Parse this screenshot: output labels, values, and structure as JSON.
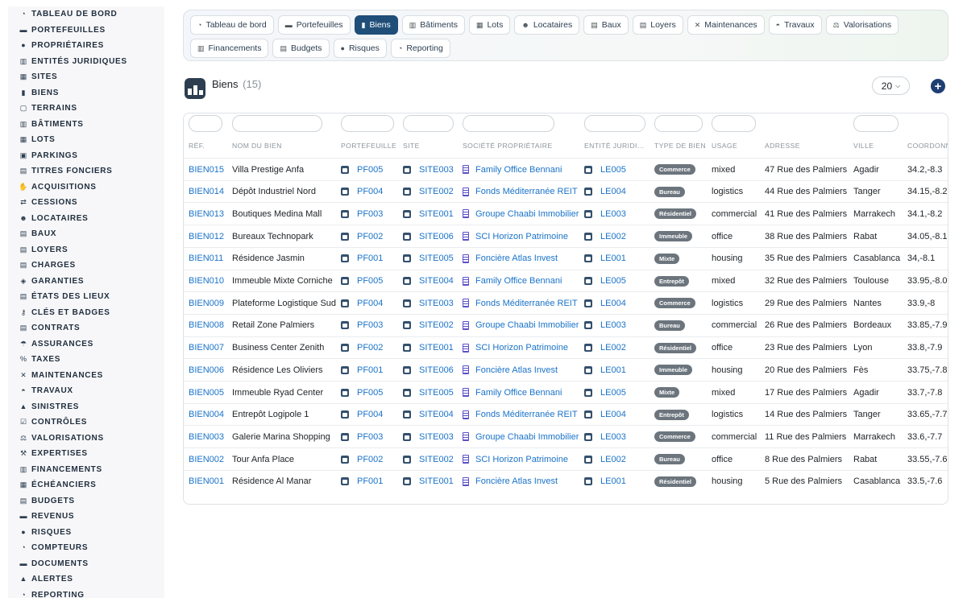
{
  "sidebar": {
    "items": [
      {
        "icon": "dashboard-icon",
        "glyph": "◔",
        "label": "Tableau de bord"
      },
      {
        "icon": "briefcase-icon",
        "glyph": "▬",
        "label": "Portefeuilles"
      },
      {
        "icon": "user-icon",
        "glyph": "●",
        "label": "Propriétaires"
      },
      {
        "icon": "building-icon",
        "glyph": "▥",
        "label": "Entités juridiques"
      },
      {
        "icon": "sites-icon",
        "glyph": "▦",
        "label": "Sites"
      },
      {
        "icon": "building-icon",
        "glyph": "▮",
        "label": "Biens"
      },
      {
        "icon": "border-icon",
        "glyph": "▢",
        "label": "Terrains"
      },
      {
        "icon": "buildings-icon",
        "glyph": "▥",
        "label": "Bâtiments"
      },
      {
        "icon": "grid-icon",
        "glyph": "▦",
        "label": "Lots"
      },
      {
        "icon": "parking-icon",
        "glyph": "▣",
        "label": "Parkings"
      },
      {
        "icon": "document-icon",
        "glyph": "▤",
        "label": "Titres fonciers"
      },
      {
        "icon": "handshake-icon",
        "glyph": "✋",
        "label": "Acquisitions"
      },
      {
        "icon": "transfer-icon",
        "glyph": "⇄",
        "label": "Cessions"
      },
      {
        "icon": "users-icon",
        "glyph": "☻",
        "label": "Locataires"
      },
      {
        "icon": "contract-icon",
        "glyph": "▤",
        "label": "Baux"
      },
      {
        "icon": "receipt-icon",
        "glyph": "▤",
        "label": "Loyers"
      },
      {
        "icon": "charges-icon",
        "glyph": "▤",
        "label": "Charges"
      },
      {
        "icon": "shield-icon",
        "glyph": "◈",
        "label": "Garanties"
      },
      {
        "icon": "clipboard-icon",
        "glyph": "▤",
        "label": "États des lieux"
      },
      {
        "icon": "key-icon",
        "glyph": "⚷",
        "label": "Clés et badges"
      },
      {
        "icon": "contract-icon",
        "glyph": "▤",
        "label": "Contrats"
      },
      {
        "icon": "umbrella-icon",
        "glyph": "☂",
        "label": "Assurances"
      },
      {
        "icon": "percent-icon",
        "glyph": "%",
        "label": "Taxes"
      },
      {
        "icon": "tools-icon",
        "glyph": "✕",
        "label": "Maintenances"
      },
      {
        "icon": "helmet-icon",
        "glyph": "◓",
        "label": "Travaux"
      },
      {
        "icon": "warning-icon",
        "glyph": "▲",
        "label": "Sinistres"
      },
      {
        "icon": "checklist-icon",
        "glyph": "☑",
        "label": "Contrôles"
      },
      {
        "icon": "scale-icon",
        "glyph": "⚖",
        "label": "Valorisations"
      },
      {
        "icon": "gavel-icon",
        "glyph": "⚒",
        "label": "Expertises"
      },
      {
        "icon": "bank-icon",
        "glyph": "▥",
        "label": "Financements"
      },
      {
        "icon": "calendar-icon",
        "glyph": "▦",
        "label": "Échéanciers"
      },
      {
        "icon": "wallet-icon",
        "glyph": "▤",
        "label": "Budgets"
      },
      {
        "icon": "money-icon",
        "glyph": "▬",
        "label": "Revenus"
      },
      {
        "icon": "risk-icon",
        "glyph": "●",
        "label": "Risques"
      },
      {
        "icon": "meter-icon",
        "glyph": "◔",
        "label": "Compteurs"
      },
      {
        "icon": "folder-icon",
        "glyph": "▬",
        "label": "Documents"
      },
      {
        "icon": "bell-icon",
        "glyph": "▲",
        "label": "Alertes"
      },
      {
        "icon": "chart-icon",
        "glyph": "◔",
        "label": "Reporting"
      }
    ]
  },
  "topnav": {
    "row1": [
      {
        "icon": "dashboard-icon",
        "glyph": "◔",
        "label": "Tableau de bord",
        "active": false
      },
      {
        "icon": "briefcase-icon",
        "glyph": "▬",
        "label": "Portefeuilles",
        "active": false
      },
      {
        "icon": "building-icon",
        "glyph": "▮",
        "label": "Biens",
        "active": true
      },
      {
        "icon": "buildings-icon",
        "glyph": "▥",
        "label": "Bâtiments",
        "active": false
      },
      {
        "icon": "grid-icon",
        "glyph": "▦",
        "label": "Lots",
        "active": false
      },
      {
        "icon": "users-icon",
        "glyph": "☻",
        "label": "Locataires",
        "active": false
      },
      {
        "icon": "contract-icon",
        "glyph": "▤",
        "label": "Baux",
        "active": false
      },
      {
        "icon": "receipt-icon",
        "glyph": "▤",
        "label": "Loyers",
        "active": false
      },
      {
        "icon": "tools-icon",
        "glyph": "✕",
        "label": "Maintenances",
        "active": false
      },
      {
        "icon": "helmet-icon",
        "glyph": "◓",
        "label": "Travaux",
        "active": false
      },
      {
        "icon": "scale-icon",
        "glyph": "⚖",
        "label": "Valorisations",
        "active": false
      }
    ],
    "row2": [
      {
        "icon": "bank-icon",
        "glyph": "▥",
        "label": "Financements",
        "active": false
      },
      {
        "icon": "wallet-icon",
        "glyph": "▤",
        "label": "Budgets",
        "active": false
      },
      {
        "icon": "risk-icon",
        "glyph": "●",
        "label": "Risques",
        "active": false
      },
      {
        "icon": "chart-icon",
        "glyph": "◔",
        "label": "Reporting",
        "active": false
      }
    ]
  },
  "header": {
    "title": "Biens",
    "count": "(15)",
    "per_page": "20"
  },
  "table": {
    "columns": [
      "Réf.",
      "Nom du bien",
      "Portefeuille",
      "Site",
      "Société propriétaire",
      "Entité juridi…",
      "Type de bien",
      "Usage",
      "Adresse",
      "Ville",
      "Coordonn"
    ],
    "rows": [
      {
        "ref": "BIEN015",
        "name": "Villa Prestige Anfa",
        "portfolio": "PF005",
        "site": "SITE003",
        "owner": "Family Office Bennani",
        "entity": "LE005",
        "type": "Commerce",
        "usage": "mixed",
        "address": "47 Rue des Palmiers",
        "city": "Agadir",
        "coords": "34.2,-8.3"
      },
      {
        "ref": "BIEN014",
        "name": "Dépôt Industriel Nord",
        "portfolio": "PF004",
        "site": "SITE002",
        "owner": "Fonds Méditerranée REIT",
        "entity": "LE004",
        "type": "Bureau",
        "usage": "logistics",
        "address": "44 Rue des Palmiers",
        "city": "Tanger",
        "coords": "34.15,-8.25"
      },
      {
        "ref": "BIEN013",
        "name": "Boutiques Medina Mall",
        "portfolio": "PF003",
        "site": "SITE001",
        "owner": "Groupe Chaabi Immobilier",
        "entity": "LE003",
        "type": "Résidentiel",
        "usage": "commercial",
        "address": "41 Rue des Palmiers",
        "city": "Marrakech",
        "coords": "34.1,-8.2"
      },
      {
        "ref": "BIEN012",
        "name": "Bureaux Technopark",
        "portfolio": "PF002",
        "site": "SITE006",
        "owner": "SCI Horizon Patrimoine",
        "entity": "LE002",
        "type": "Immeuble",
        "usage": "office",
        "address": "38 Rue des Palmiers",
        "city": "Rabat",
        "coords": "34.05,-8.15"
      },
      {
        "ref": "BIEN011",
        "name": "Résidence Jasmin",
        "portfolio": "PF001",
        "site": "SITE005",
        "owner": "Foncière Atlas Invest",
        "entity": "LE001",
        "type": "Mixte",
        "usage": "housing",
        "address": "35 Rue des Palmiers",
        "city": "Casablanca",
        "coords": "34,-8.1"
      },
      {
        "ref": "BIEN010",
        "name": "Immeuble Mixte Corniche",
        "portfolio": "PF005",
        "site": "SITE004",
        "owner": "Family Office Bennani",
        "entity": "LE005",
        "type": "Entrepôt",
        "usage": "mixed",
        "address": "32 Rue des Palmiers",
        "city": "Toulouse",
        "coords": "33.95,-8.05"
      },
      {
        "ref": "BIEN009",
        "name": "Plateforme Logistique Sud",
        "portfolio": "PF004",
        "site": "SITE003",
        "owner": "Fonds Méditerranée REIT",
        "entity": "LE004",
        "type": "Commerce",
        "usage": "logistics",
        "address": "29 Rue des Palmiers",
        "city": "Nantes",
        "coords": "33.9,-8"
      },
      {
        "ref": "BIEN008",
        "name": "Retail Zone Palmiers",
        "portfolio": "PF003",
        "site": "SITE002",
        "owner": "Groupe Chaabi Immobilier",
        "entity": "LE003",
        "type": "Bureau",
        "usage": "commercial",
        "address": "26 Rue des Palmiers",
        "city": "Bordeaux",
        "coords": "33.85,-7.95"
      },
      {
        "ref": "BIEN007",
        "name": "Business Center Zenith",
        "portfolio": "PF002",
        "site": "SITE001",
        "owner": "SCI Horizon Patrimoine",
        "entity": "LE002",
        "type": "Résidentiel",
        "usage": "office",
        "address": "23 Rue des Palmiers",
        "city": "Lyon",
        "coords": "33.8,-7.9"
      },
      {
        "ref": "BIEN006",
        "name": "Résidence Les Oliviers",
        "portfolio": "PF001",
        "site": "SITE006",
        "owner": "Foncière Atlas Invest",
        "entity": "LE001",
        "type": "Immeuble",
        "usage": "housing",
        "address": "20 Rue des Palmiers",
        "city": "Fès",
        "coords": "33.75,-7.85"
      },
      {
        "ref": "BIEN005",
        "name": "Immeuble Ryad Center",
        "portfolio": "PF005",
        "site": "SITE005",
        "owner": "Family Office Bennani",
        "entity": "LE005",
        "type": "Mixte",
        "usage": "mixed",
        "address": "17 Rue des Palmiers",
        "city": "Agadir",
        "coords": "33.7,-7.8"
      },
      {
        "ref": "BIEN004",
        "name": "Entrepôt Logipole 1",
        "portfolio": "PF004",
        "site": "SITE004",
        "owner": "Fonds Méditerranée REIT",
        "entity": "LE004",
        "type": "Entrepôt",
        "usage": "logistics",
        "address": "14 Rue des Palmiers",
        "city": "Tanger",
        "coords": "33.65,-7.75"
      },
      {
        "ref": "BIEN003",
        "name": "Galerie Marina Shopping",
        "portfolio": "PF003",
        "site": "SITE003",
        "owner": "Groupe Chaabi Immobilier",
        "entity": "LE003",
        "type": "Commerce",
        "usage": "commercial",
        "address": "11 Rue des Palmiers",
        "city": "Marrakech",
        "coords": "33.6,-7.7"
      },
      {
        "ref": "BIEN002",
        "name": "Tour Anfa Place",
        "portfolio": "PF002",
        "site": "SITE002",
        "owner": "SCI Horizon Patrimoine",
        "entity": "LE002",
        "type": "Bureau",
        "usage": "office",
        "address": "8 Rue des Palmiers",
        "city": "Rabat",
        "coords": "33.55,-7.65"
      },
      {
        "ref": "BIEN001",
        "name": "Résidence Al Manar",
        "portfolio": "PF001",
        "site": "SITE001",
        "owner": "Foncière Atlas Invest",
        "entity": "LE001",
        "type": "Résidentiel",
        "usage": "housing",
        "address": "5 Rue des Palmiers",
        "city": "Casablanca",
        "coords": "33.5,-7.6"
      }
    ]
  }
}
